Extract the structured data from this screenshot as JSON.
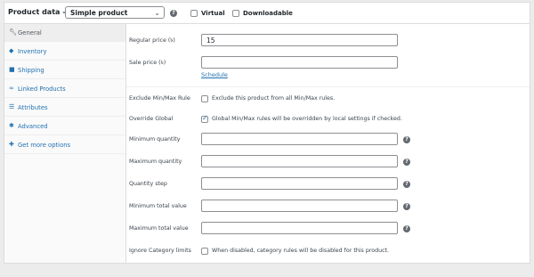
{
  "header": {
    "title": "Product data —",
    "product_type": "Simple product",
    "virtual_label": "Virtual",
    "downloadable_label": "Downloadable"
  },
  "sidebar": {
    "tabs": [
      {
        "label": "General",
        "icon": "wrench-icon",
        "active": true
      },
      {
        "label": "Inventory",
        "icon": "tag-icon"
      },
      {
        "label": "Shipping",
        "icon": "truck-icon"
      },
      {
        "label": "Linked Products",
        "icon": "link-icon"
      },
      {
        "label": "Attributes",
        "icon": "list-icon"
      },
      {
        "label": "Advanced",
        "icon": "gear-icon"
      },
      {
        "label": "Get more options",
        "icon": "plug-icon"
      }
    ]
  },
  "general": {
    "regular_price_label": "Regular price (৳)",
    "regular_price_value": "15",
    "sale_price_label": "Sale price (৳)",
    "sale_price_value": "",
    "schedule_link": "Schedule"
  },
  "minmax": {
    "exclude_label": "Exclude Min/Max Rule",
    "exclude_desc": "Exclude this product from all Min/Max rules.",
    "exclude_checked": false,
    "override_label": "Override Global",
    "override_desc": "Global Min/Max rules will be overridden by local settings if checked.",
    "override_checked": true,
    "min_qty_label": "Minimum quantity",
    "max_qty_label": "Maximum quantity",
    "qty_step_label": "Quantity step",
    "min_total_label": "Minimum total value",
    "max_total_label": "Maximum total value",
    "ignore_cat_label": "Ignore Category limits",
    "ignore_cat_desc": "When disabled, category rules will be disabled for this product."
  }
}
